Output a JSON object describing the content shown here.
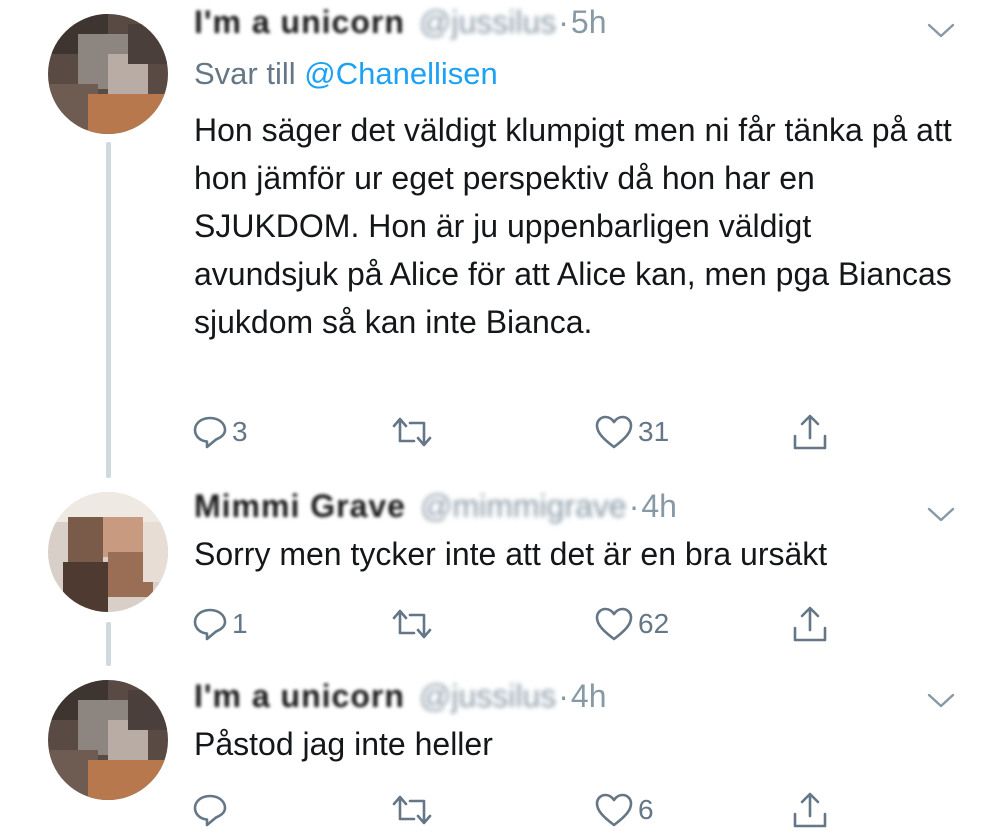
{
  "tweets": [
    {
      "name": "I'm a unicorn",
      "handle": "@jussilus",
      "dot": "·",
      "time": "5h",
      "reply_label": "Svar till",
      "reply_mention": "@Chanellisen",
      "text": "Hon säger det väldigt klumpigt men ni får tänka på att hon jämför ur eget perspektiv då hon har en SJUKDOM. Hon är ju uppenbarligen väldigt avundsjuk på Alice för att Alice kan, men pga Biancas sjukdom så kan inte Bianca.",
      "replies": "3",
      "retweets": "",
      "likes": "31"
    },
    {
      "name": "Mimmi Grave",
      "handle": "@mimmigrave",
      "dot": "·",
      "time": "4h",
      "text": "Sorry men tycker inte att det är en bra ursäkt",
      "replies": "1",
      "retweets": "",
      "likes": "62"
    },
    {
      "name": "I'm a unicorn",
      "handle": "@jussilus",
      "dot": "·",
      "time": "4h",
      "text": "Påstod jag inte heller",
      "replies": "",
      "retweets": "",
      "likes": "6"
    }
  ],
  "icons": {
    "reply": "reply-icon",
    "retweet": "retweet-icon",
    "like": "heart-icon",
    "share": "share-icon",
    "more": "chevron-down-icon"
  },
  "colors": {
    "link": "#1da1f2",
    "muted": "#657786",
    "thread_line": "#cfd9de"
  }
}
